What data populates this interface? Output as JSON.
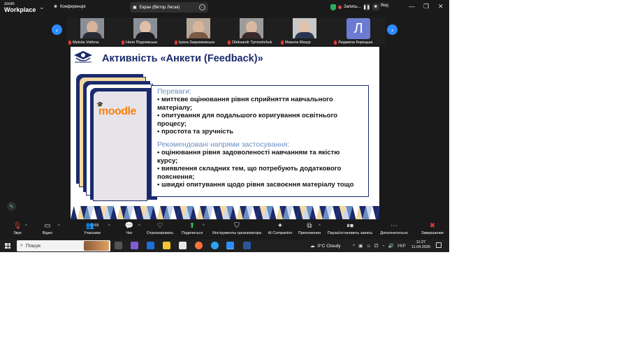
{
  "app": {
    "logo_line1": "zoom",
    "logo_line2": "Workplace"
  },
  "topbar": {
    "conference_label": "Конференція",
    "share_label": "Екран (Віктор Лисак)",
    "recording_label": "Запись...",
    "view_label": "Вид"
  },
  "participants": [
    {
      "name": "Mykola Vokhna",
      "type": "photo"
    },
    {
      "name": "Неля Подлевська",
      "type": "photo"
    },
    {
      "name": "Ірина Закрижевська",
      "type": "photo"
    },
    {
      "name": "Oleksandr Tymoshchuk",
      "type": "photo"
    },
    {
      "name": "Микола Мазур",
      "type": "photo"
    },
    {
      "name": "Людмила Корецька",
      "type": "avatar",
      "initial": "Л"
    }
  ],
  "slide": {
    "title": "Активність «Анкети (Feedback)»",
    "moodle_text": "moodle",
    "advantages_heading": "Переваги:",
    "advantages": [
      "• миттєве оцінювання рівня сприйняття навчального",
      "матеріалу;",
      "• опитування для подальшого коригування освітнього",
      "процесу;",
      "• простота та зручність"
    ],
    "recommend_heading": "Рекомендовані напрями застосування:",
    "recommend": [
      "• оцінювання рівня задоволеності навчанням та якістю",
      "курсу;",
      "• виявлення складних тем, що потребують додаткового",
      "пояснення;",
      "• швидкі опитування щодо рівня засвоєння матеріалу тощо"
    ]
  },
  "toolbar": {
    "audio": "Звук",
    "video": "Відео",
    "participants": "Учасники",
    "participants_count": "69",
    "chat": "Чат",
    "react": "Отреагировать",
    "share": "Поделиться",
    "host_tools": "Инструменты организатора",
    "ai": "AI Companion",
    "apps": "Приложения",
    "record": "Пауза/остановить запись",
    "more": "Дополнительно",
    "end": "Завершение"
  },
  "taskbar": {
    "search_label": "Пошук",
    "weather": "0°C  Cloudy",
    "lang": "УКР",
    "time": "11:27",
    "date": "11.04.2025"
  },
  "colors": {
    "accent": "#2d8cff",
    "slide_title": "#1a2a6c",
    "moodle": "#f98012",
    "heading": "#6b8fc4"
  }
}
